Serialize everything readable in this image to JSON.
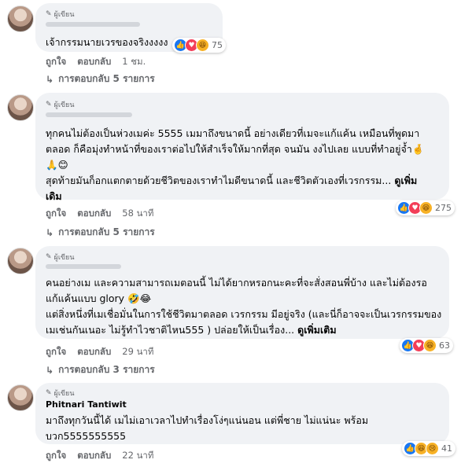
{
  "comments": [
    {
      "badge": "ผู้เขียน",
      "name": "",
      "text": [
        "เจ้ากรรมนายเวรของจริงงงงง"
      ],
      "more": "",
      "like_label": "ถูกใจ",
      "reply_label": "ตอบกลับ",
      "time": "1 ชม.",
      "replies": "การตอบกลับ 5 รายการ",
      "reaction_count": "75",
      "reactions": [
        "like",
        "love",
        "haha"
      ]
    },
    {
      "badge": "ผู้เขียน",
      "name": "",
      "text": [
        "ทุกคนไม่ต้องเป็นห่วงเมค่ะ 5555 เมมาถึงขนาดนี้ อย่างเดียวที่เมจะแก้แค้น เหมือนที่พูดมา",
        "ตลอด ก็คือมุ่งทำหน้าที่ของเราต่อไปให้สำเร็จให้มากที่สุด จนมัน งงไปเลย แบบที่ทำอยู่จ้ำ🤞",
        "🙏😊",
        "สุดท้ายมันก็อกแตกตายด้วยชีวิตของเราทำไมดีขนาดนี้ และชีวิตตัวเองที่เวรกรรม...",
        "เดิม"
      ],
      "more": "ดูเพิ่ม",
      "like_label": "ถูกใจ",
      "reply_label": "ตอบกลับ",
      "time": "58 นาที",
      "replies": "การตอบกลับ 5 รายการ",
      "reaction_count": "275",
      "reactions": [
        "like",
        "love",
        "haha"
      ]
    },
    {
      "badge": "ผู้เขียน",
      "name": "",
      "text": [
        "คนอย่างเม และความสามารถเมตอนนี้ ไม่ได้ยากหรอกนะคะที่จะสั่งสอนพี่บ้าง และไม่ต้องรอ",
        "แก้แค้นแบบ glory 🤣😂",
        "แต่สิ่งหนึ่งที่เมเชื่อมั่นในการใช้ชีวิตมาตลอด เวรกรรม มีอยู่จริง (และนี่ก็อาจจะเป็นเวรกรรมของ",
        "เมเช่นกันเนอะ ไม่รู้ทำไวชาติไหน555 ) ปล่อยให้เป็นเรื่อง..."
      ],
      "more": "ดูเพิ่มเติม",
      "like_label": "ถูกใจ",
      "reply_label": "ตอบกลับ",
      "time": "29 นาที",
      "replies": "การตอบกลับ 3 รายการ",
      "reaction_count": "63",
      "reactions": [
        "like",
        "love",
        "haha"
      ]
    },
    {
      "badge": "ผู้เขียน",
      "name": "Phitnari Tantiwit",
      "text": [
        "มาถึงทุกวันนี้ได้ เมไม่เอาเวลาไปทำเรื่องโง่ๆแน่นอน แต่พี่ชาย  ไม่แน่นะ พร้อม",
        "บวก5555555555"
      ],
      "more": "",
      "like_label": "ถูกใจ",
      "reply_label": "ตอบกลับ",
      "time": "22 นาที",
      "replies": "",
      "reaction_count": "41",
      "reactions": [
        "like",
        "haha",
        "sad"
      ]
    }
  ]
}
